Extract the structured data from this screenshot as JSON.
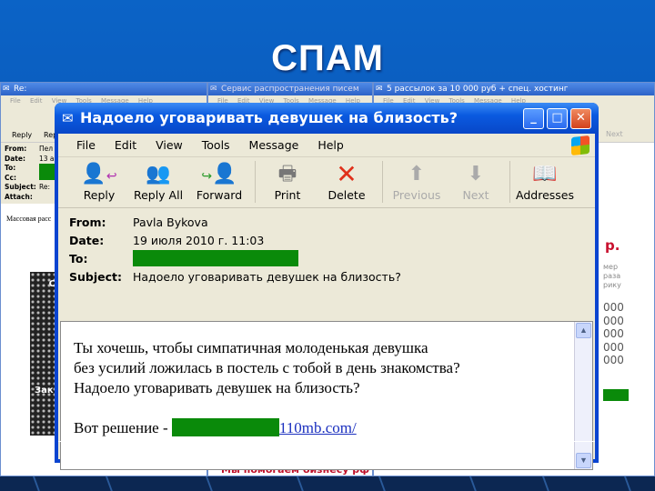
{
  "slide": {
    "title": "СПАМ"
  },
  "bg_windows": {
    "left": {
      "title": "Re:",
      "menu": "File Edit View Tools Message Help",
      "reply": "Reply",
      "reply2": "Rep",
      "headers": [
        {
          "label": "From:",
          "value": "Пел"
        },
        {
          "label": "Date:",
          "value": "13 а"
        },
        {
          "label": "To:",
          "value": ""
        },
        {
          "label": "Cc:",
          "value": ""
        },
        {
          "label": "Subject:",
          "value": "Re:"
        },
        {
          "label": "Attach:",
          "value": ""
        }
      ],
      "body_text": "Массовая расс",
      "banner_top": "С",
      "banner_bottom": "Зак"
    },
    "middle": {
      "title": "Сервис распространения писем",
      "menu": "File Edit View Tools Message Help",
      "footer_text": "Мы помогаем бизнесу рф"
    },
    "right": {
      "title": "5 рассылок за 10 000 руб + спец. хостинг",
      "menu": "File Edit View Tools Message Help",
      "next": "Next",
      "price_suffix": "р.",
      "lines": [
        "мер",
        "раза",
        "рику"
      ],
      "numbers": [
        "000",
        "000",
        "000",
        "000",
        "000"
      ]
    }
  },
  "window": {
    "title": "Надоело уговаривать девушек на близость?",
    "menu": [
      "File",
      "Edit",
      "View",
      "Tools",
      "Message",
      "Help"
    ],
    "toolbar": [
      {
        "label": "Reply",
        "icon": "reply-icon"
      },
      {
        "label": "Reply All",
        "icon": "reply-all-icon"
      },
      {
        "label": "Forward",
        "icon": "forward-icon"
      },
      {
        "label": "Print",
        "icon": "printer-icon"
      },
      {
        "label": "Delete",
        "icon": "delete-icon"
      },
      {
        "label": "Previous",
        "icon": "up-arrow-icon",
        "disabled": true
      },
      {
        "label": "Next",
        "icon": "down-arrow-icon",
        "disabled": true
      },
      {
        "label": "Addresses",
        "icon": "address-book-icon"
      }
    ],
    "headers": {
      "from_label": "From:",
      "from": "Pavla Bykova",
      "date_label": "Date:",
      "date": "19 июля 2010 г. 11:03",
      "to_label": "To:",
      "subject_label": "Subject:",
      "subject": "Надоело уговаривать девушек на близость?"
    },
    "body": {
      "line1": "Ты хочешь, чтобы симпатичная молоденькая девушка",
      "line2": "без усилий ложилась в постель с тобой в день знакомства?",
      "line3": "Надоело уговаривать девушек на близость?",
      "solution": "Вот решение -",
      "link": "110mb.com/"
    }
  },
  "colors": {
    "redaction": "#0a8a0a",
    "titlebar": "#0a5ae0",
    "slide_bg": "#0b5cc0"
  }
}
